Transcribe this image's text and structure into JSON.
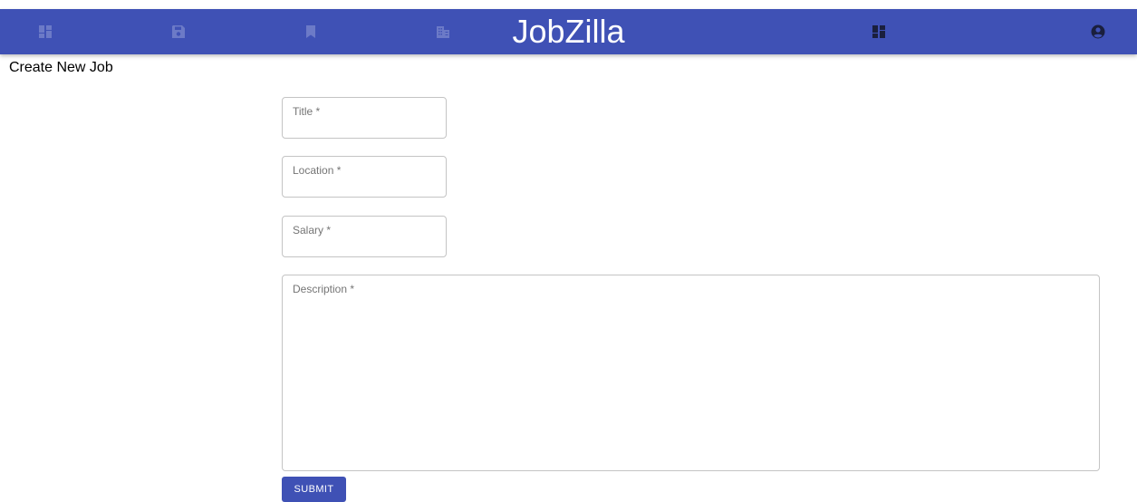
{
  "app": {
    "brand": "JobZilla",
    "colors": {
      "appbar": "#3f51b5",
      "icon_muted": "#6c7ac7",
      "icon_active": "#1a1f3d",
      "button": "#3f51b5"
    }
  },
  "nav": {
    "icons": [
      {
        "icon": "dashboard-icon",
        "state": "muted"
      },
      {
        "icon": "save-icon",
        "state": "muted"
      },
      {
        "icon": "bookmark-icon",
        "state": "muted"
      },
      {
        "icon": "business-icon",
        "state": "muted"
      },
      {
        "icon": "dashboard-icon",
        "state": "active"
      },
      {
        "icon": "account-circle-icon",
        "state": "active"
      }
    ]
  },
  "page": {
    "title": "Create New Job"
  },
  "form": {
    "title_label": "Title *",
    "title_value": "",
    "location_label": "Location *",
    "location_value": "",
    "salary_label": "Salary *",
    "salary_value": "",
    "description_label": "Description *",
    "description_value": "",
    "submit_label": "SUBMIT"
  }
}
